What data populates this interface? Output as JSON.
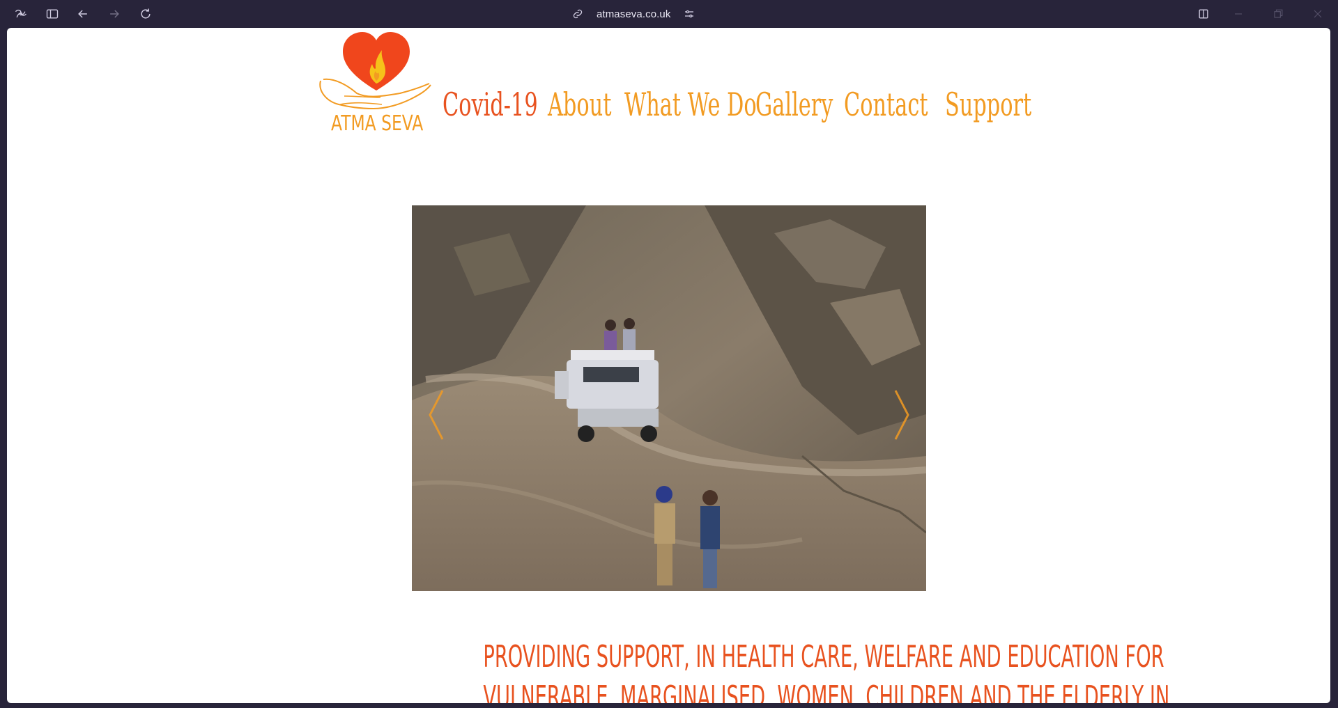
{
  "browser": {
    "url": "atmaseva.co.uk",
    "icons": [
      "browser-logo-icon",
      "sidebar-toggle-icon",
      "back-arrow-icon",
      "forward-arrow-icon",
      "reload-icon",
      "link-icon",
      "site-settings-icon",
      "split-view-icon",
      "minimize-icon",
      "restore-icon",
      "close-icon"
    ]
  },
  "site": {
    "logo_text": "ATMA SEVA",
    "nav": [
      {
        "label": "Covid-19"
      },
      {
        "label": "About"
      },
      {
        "label": "What We Do"
      },
      {
        "label": "Gallery"
      },
      {
        "label": "Contact"
      },
      {
        "label": "Support"
      }
    ],
    "slider": {
      "prev_icon": "chevron-left-icon",
      "next_icon": "chevron-right-icon"
    },
    "tagline": [
      "PROVIDING SUPPORT, IN HEALTH CARE, WELFARE AND EDUCATION FOR",
      "VULNERABLE, MARGINALISED, WOMEN, CHILDREN AND THE ELDERLY IN"
    ]
  },
  "colors": {
    "chrome_bg": "#28243a",
    "brand_orange": "#f29b22",
    "brand_red": "#e8521f",
    "page_bg": "#ffffff"
  }
}
